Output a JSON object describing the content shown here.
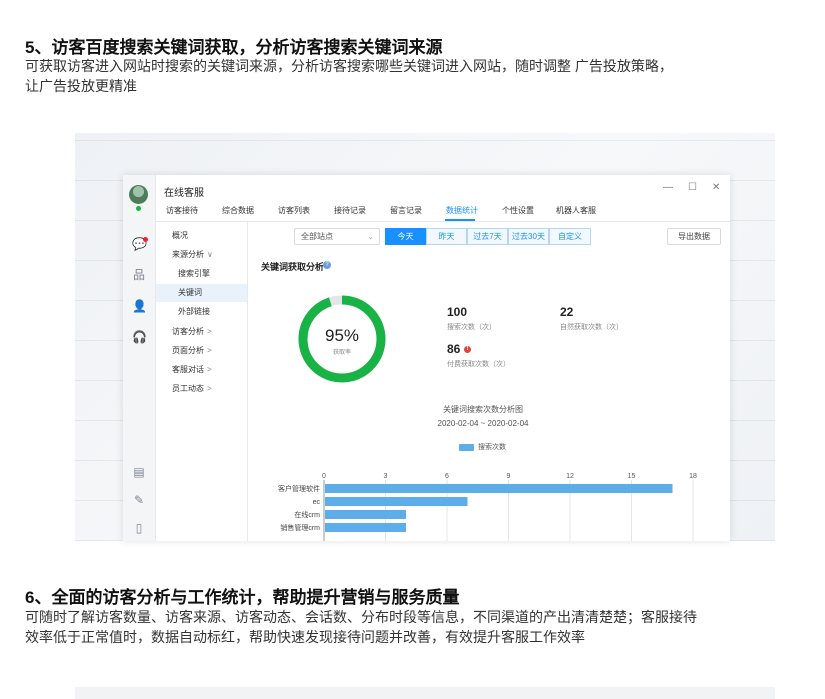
{
  "section5": {
    "title": "5、访客百度搜索关键词获取，分析访客搜索关键词来源",
    "line1": "可获取访客进入网站时搜索的关键词来源，分析访客搜索哪些关键词进入网站，随时调整        广告投放策略，",
    "line2": "让广告投放更精准"
  },
  "app": {
    "title": "在线客服",
    "window_controls": [
      "—",
      "☐",
      "✕"
    ],
    "tabs": [
      "访客接待",
      "综合数据",
      "访客列表",
      "接待记录",
      "留言记录",
      "数据统计",
      "个性设置",
      "机器人客服"
    ],
    "active_tab": "数据统计",
    "sidebar_icons": [
      "chat-icon",
      "org-icon",
      "contacts-icon",
      "headset-icon",
      "doc-icon",
      "edit-icon",
      "file-icon"
    ],
    "subnav": [
      {
        "label": "概况",
        "caret": ""
      },
      {
        "label": "来源分析",
        "caret": "∨"
      },
      {
        "label": "搜索引擎",
        "caret": ""
      },
      {
        "label": "关键词",
        "caret": ""
      },
      {
        "label": "外部链接",
        "caret": ""
      },
      {
        "label": "访客分析",
        "caret": ">"
      },
      {
        "label": "页面分析",
        "caret": ">"
      },
      {
        "label": "客服对话",
        "caret": ">"
      },
      {
        "label": "员工动态",
        "caret": ">"
      }
    ],
    "active_subnav": "关键词",
    "filter": {
      "site_select": "全部站点",
      "ranges": [
        "今天",
        "昨天",
        "过去7天",
        "过去30天",
        "自定义"
      ],
      "active_range": "今天",
      "export": "导出数据"
    },
    "keyword_panel": {
      "heading": "关键词获取分析",
      "rate": "95%",
      "rate_label": "获取率",
      "rate_value": 0.95,
      "colors": {
        "primary": "#19b244",
        "track": "#e3e5e8",
        "bar": "#5dade8",
        "accent": "#1890ff"
      },
      "stats": [
        {
          "value": "100",
          "label": "搜索次数（次）"
        },
        {
          "value": "22",
          "label": "自然获取次数（次）"
        },
        {
          "value": "86",
          "label": "付费获取次数（次）"
        }
      ]
    }
  },
  "chart_data": {
    "type": "bar",
    "orientation": "horizontal",
    "title": "关键词搜索次数分析图",
    "subtitle": "2020-02-04 ~ 2020-02-04",
    "categories": [
      "客户管理软件",
      "ec",
      "在线crm",
      "销售管理crm"
    ],
    "series": [
      {
        "name": "搜索次数",
        "values": [
          17,
          7,
          4,
          4
        ]
      }
    ],
    "xlim": [
      0,
      18
    ],
    "xticks": [
      0,
      3,
      6,
      9,
      12,
      15,
      18
    ],
    "grid": true,
    "legend": "top-center"
  },
  "section6": {
    "title": "6、全面的访客分析与工作统计，帮助提升营销与服务质量",
    "line1": "可随时了解访客数量、访客来源、访客动态、会话数、分布时段等信息，不同渠道的产出清清楚楚；客服接待",
    "line2": "效率低于正常值时，数据自动标红，帮助快速发现接待问题并改善，有效提升客服工作效率"
  }
}
